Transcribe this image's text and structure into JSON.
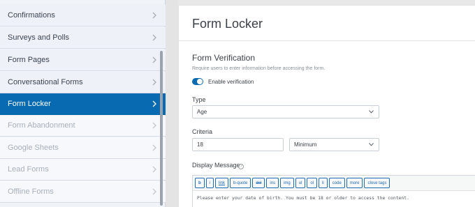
{
  "sidebar": {
    "items": [
      {
        "label": "Confirmations",
        "state": "normal"
      },
      {
        "label": "Surveys and Polls",
        "state": "normal"
      },
      {
        "label": "Form Pages",
        "state": "normal"
      },
      {
        "label": "Conversational Forms",
        "state": "normal"
      },
      {
        "label": "Form Locker",
        "state": "active"
      },
      {
        "label": "Form Abandonment",
        "state": "disabled"
      },
      {
        "label": "Google Sheets",
        "state": "disabled"
      },
      {
        "label": "Lead Forms",
        "state": "disabled"
      },
      {
        "label": "Offline Forms",
        "state": "disabled"
      }
    ]
  },
  "panel": {
    "title": "Form Locker",
    "section_title": "Form Verification",
    "section_desc": "Require users to enter information before accessing the form.",
    "toggle": {
      "label": "Enable verification",
      "enabled": true
    },
    "type": {
      "label": "Type",
      "value": "Age"
    },
    "criteria": {
      "label": "Criteria",
      "value": "18",
      "mode": "Minimum"
    },
    "display_message": {
      "label": "Display Message",
      "help_glyph": "?",
      "toolbar": [
        "b",
        "i",
        "link",
        "b-quote",
        "del",
        "ins",
        "img",
        "ul",
        "ol",
        "li",
        "code",
        "more",
        "close tags"
      ],
      "content": "Please enter your date of birth. You must be 18 or older to access the content."
    }
  },
  "colors": {
    "accent": "#086ab0",
    "sidebar_bg": "#eef2f8",
    "toolbar_button": "#1e6bb8"
  },
  "icons": {
    "sidebar_chevron": "chevron-right-icon",
    "dropdown": "chevron-down-icon",
    "help": "help-circle-icon"
  }
}
